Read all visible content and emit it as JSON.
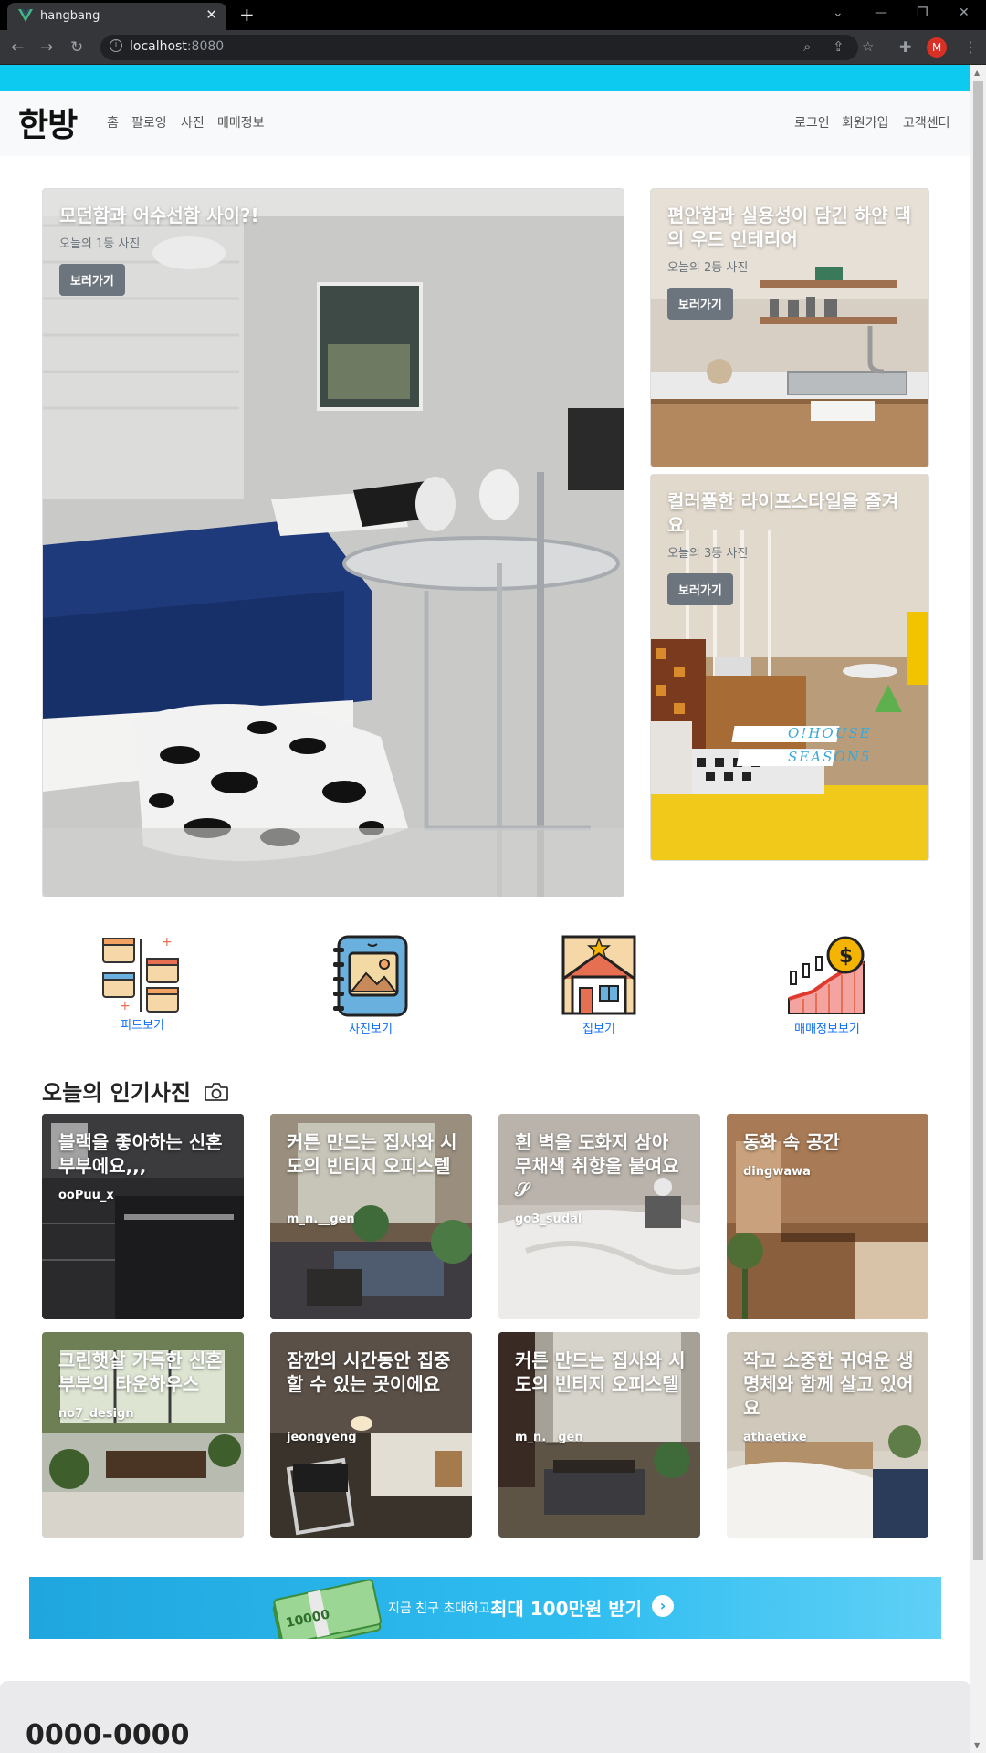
{
  "browser": {
    "tab_title": "hangbang",
    "url_host": "localhost",
    "url_port": ":8080",
    "avatar_letter": "M"
  },
  "header": {
    "logo": "한방",
    "nav": [
      "홈",
      "팔로잉",
      "사진",
      "매매정보"
    ],
    "right": [
      "로그인",
      "회원가입",
      "고객센터"
    ]
  },
  "hero": [
    {
      "title": "모던함과 어수선함 사이?!",
      "subtitle": "오늘의 1등 사진",
      "button": "보러가기"
    },
    {
      "title": "편안함과 실용성이 담긴 하얀 댁의 우드 인테리어",
      "subtitle": "오늘의 2등 사진",
      "button": "보러가기"
    },
    {
      "title": "컬러풀한 라이프스타일을 즐겨요",
      "subtitle": "오늘의 3등 사진",
      "button": "보러가기",
      "overlay1": "O!HOUSE",
      "overlay2": "SEASON5"
    }
  ],
  "categories": [
    {
      "label": "피드보기",
      "icon": "feed-icon"
    },
    {
      "label": "사진보기",
      "icon": "photo-book-icon"
    },
    {
      "label": "집보기",
      "icon": "house-icon"
    },
    {
      "label": "매매정보보기",
      "icon": "market-chart-icon"
    }
  ],
  "popular": {
    "title": "오늘의 인기사진",
    "items": [
      {
        "title": "블랙을 좋아하는 신혼부부에요,,,",
        "user": "ooPuu_x"
      },
      {
        "title": "커튼 만드는 집사와 시도의 빈티지 오피스텔",
        "user": "m_n.__gen"
      },
      {
        "title": "흰 벽을 도화지 삼아 무채색 취향을 붙여요 𝒮",
        "user": "go3_sudal"
      },
      {
        "title": "동화 속 공간",
        "user": "dingwawa"
      },
      {
        "title": "그린햇살 가득한 신혼부부의 타운하우스",
        "user": "no7_design"
      },
      {
        "title": "잠깐의 시간동안 집중할 수 있는 곳이에요",
        "user": "jeongyeng"
      },
      {
        "title": "커튼 만드는 집사와 시도의 빈티지 오피스텔",
        "user": "m_n.__gen"
      },
      {
        "title": "작고 소중한 귀여운 생명체와 함께 살고 있어요",
        "user": "athaetixe"
      }
    ]
  },
  "banner": {
    "small": "지금 친구 초대하고",
    "big": "최대 100만원 받기",
    "money": "10000"
  },
  "footer": {
    "phone": "0000-0000"
  },
  "colors": {
    "accent": "#0dcaf0",
    "link": "#0d6efd",
    "button": "#6c757d"
  }
}
